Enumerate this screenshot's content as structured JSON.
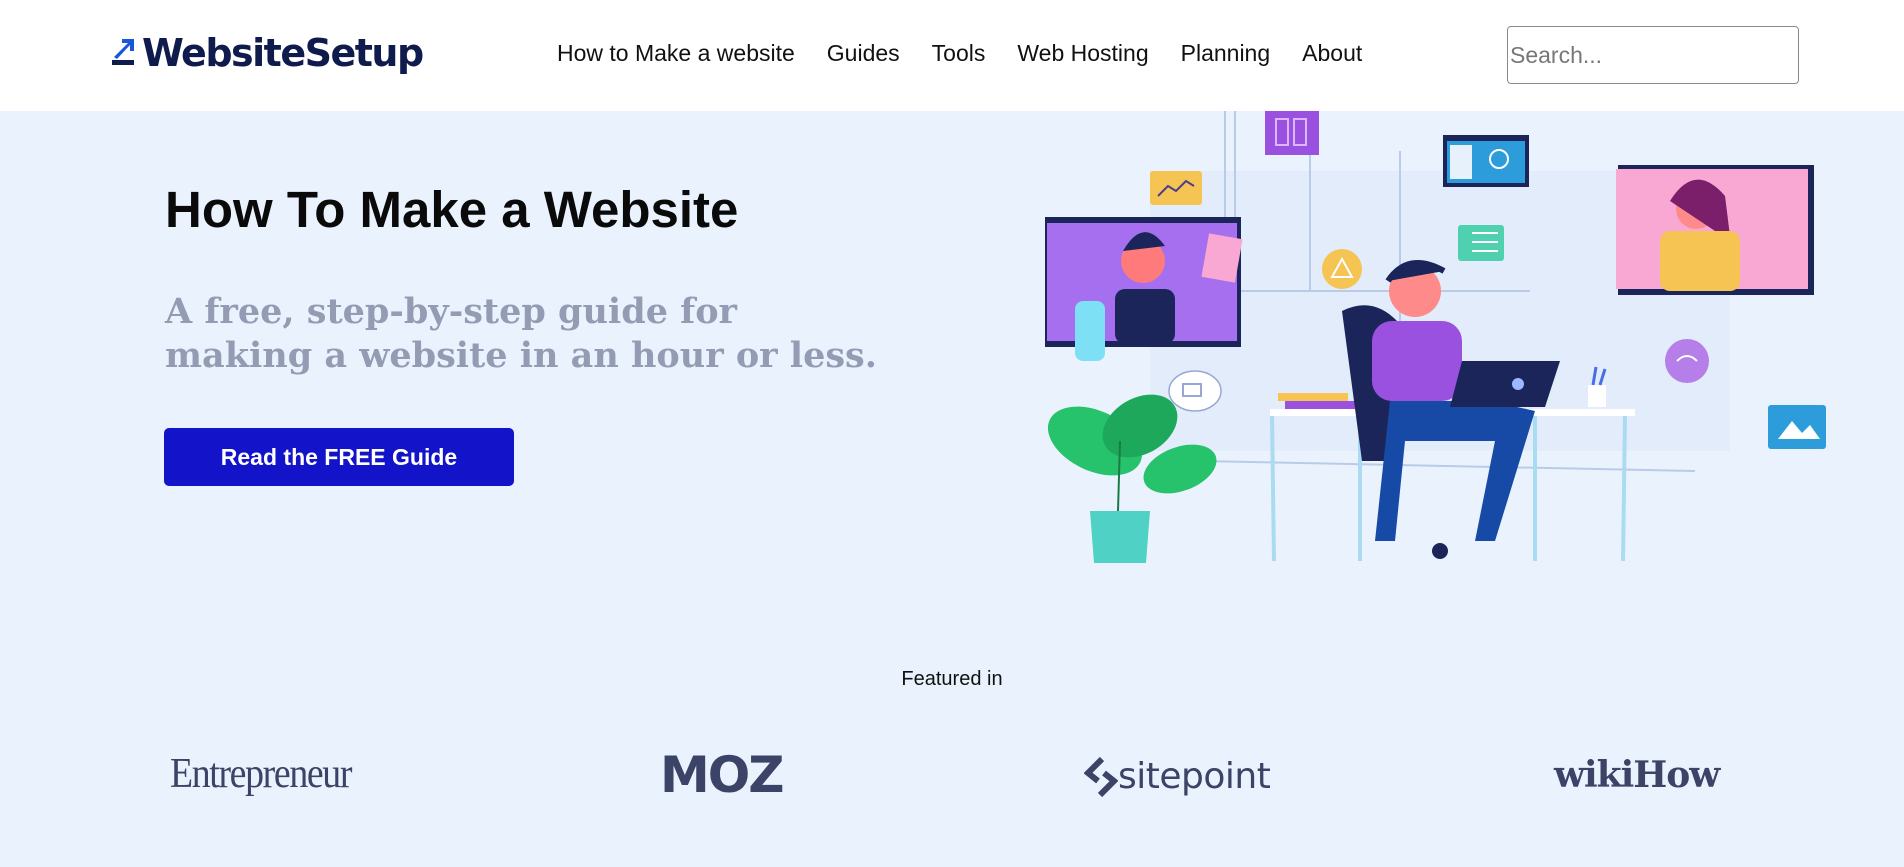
{
  "header": {
    "logo_text": "WebsiteSetup",
    "nav": [
      "How to Make a website",
      "Guides",
      "Tools",
      "Web Hosting",
      "Planning",
      "About"
    ],
    "search_placeholder": "Search..."
  },
  "hero": {
    "title": "How To Make a Website",
    "subtitle": "A free, step-by-step guide for making a website in an hour or less.",
    "cta_label": "Read the FREE Guide"
  },
  "featured": {
    "label": "Featured in",
    "brands": [
      "Entrepreneur",
      "MOZ",
      "sitepoint",
      "wikiHow"
    ]
  },
  "colors": {
    "page_bg": "#eaf3fd",
    "cta_bg": "#1313c9",
    "logo_blue": "#1a56db",
    "subtitle": "#939cb3"
  },
  "icons": [
    "logo-arrow-icon",
    "sitepoint-mark-icon",
    "hero-illustration"
  ]
}
